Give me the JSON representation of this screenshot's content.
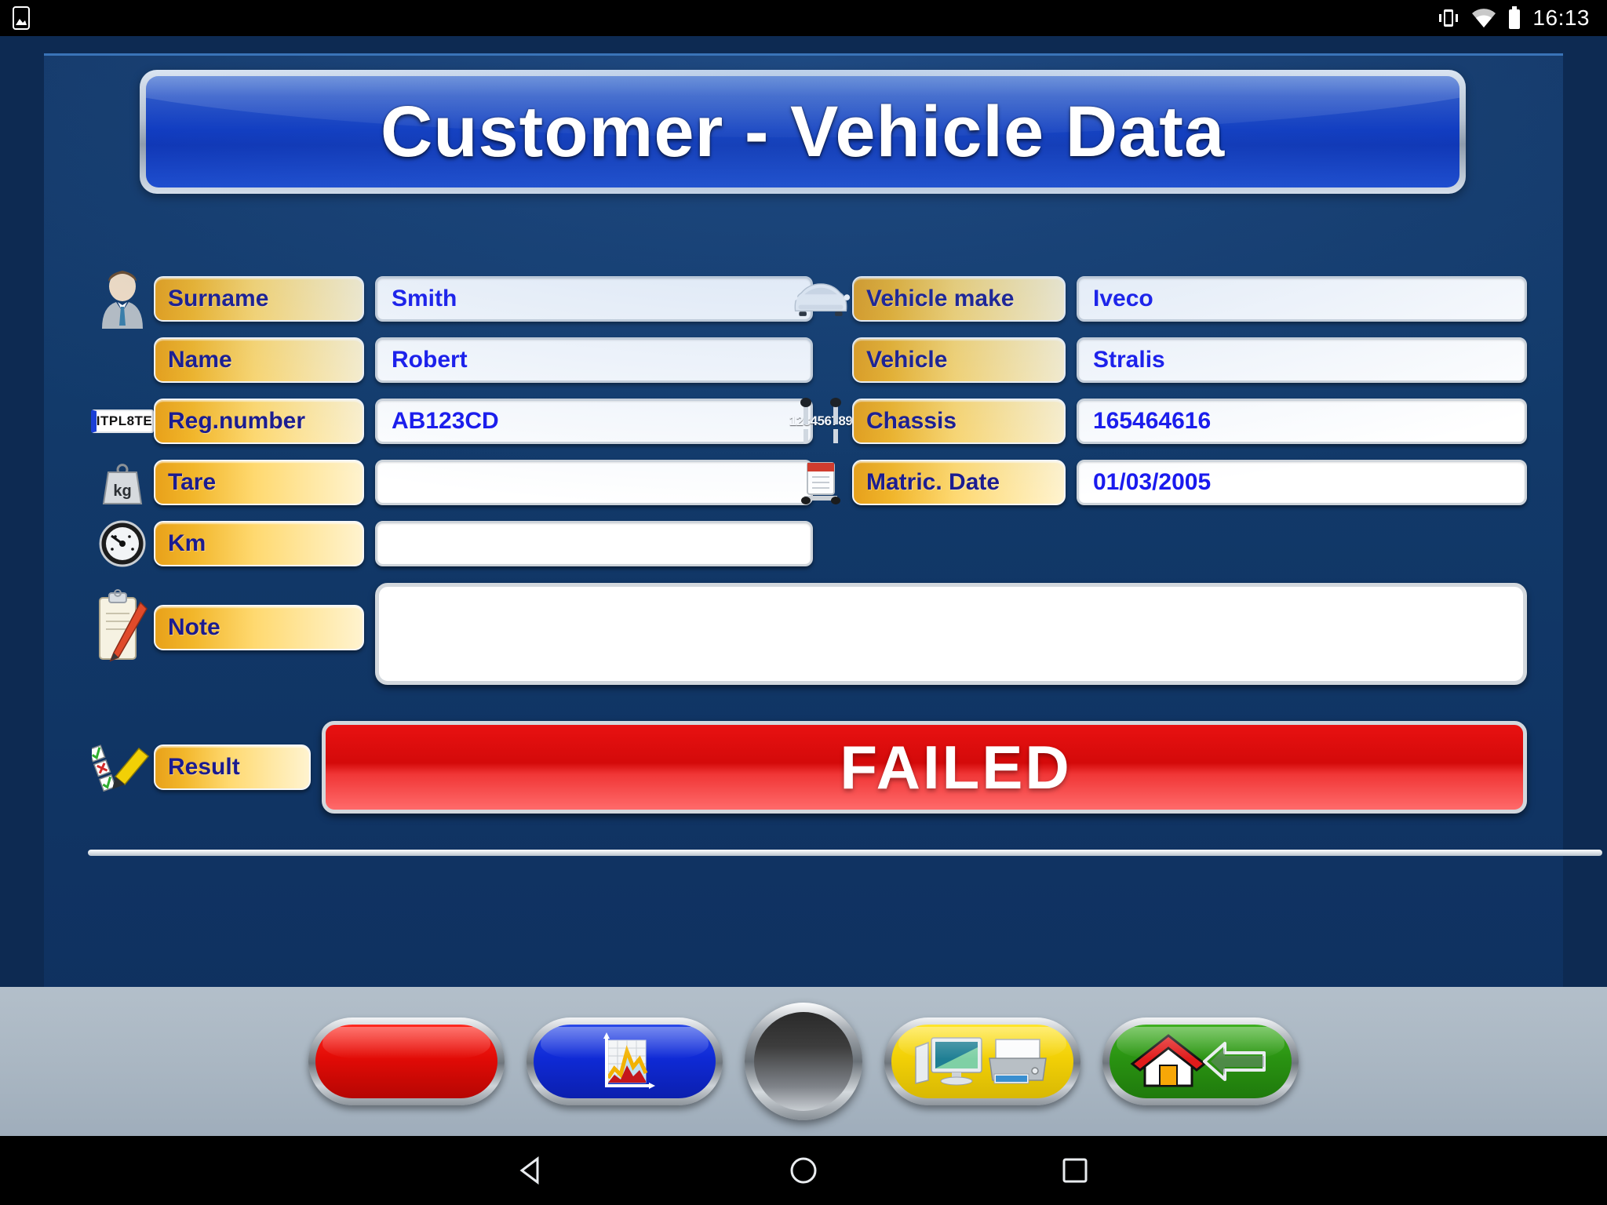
{
  "status_bar": {
    "time": "16:13",
    "icons": [
      "screenshot-icon",
      "vibrate-icon",
      "wifi-icon",
      "battery-icon"
    ]
  },
  "header": {
    "title": "Customer - Vehicle Data"
  },
  "form": {
    "left_fields": [
      {
        "icon": "person-icon",
        "label": "Surname",
        "value": "Smith"
      },
      {
        "icon": "person-icon",
        "label": "Name",
        "value": "Robert"
      },
      {
        "icon": "license-plate-icon",
        "plate_text": "ITPL8TE",
        "label": "Reg.number",
        "value": "AB123CD"
      },
      {
        "icon": "weight-kg-icon",
        "unit": "kg",
        "label": "Tare",
        "value": ""
      },
      {
        "icon": "speedometer-icon",
        "label": "Km",
        "value": ""
      }
    ],
    "right_fields": [
      {
        "icon": "car-icon",
        "label": "Vehicle make",
        "value": "Iveco"
      },
      {
        "icon": "car-icon",
        "label": "Vehicle",
        "value": "Stralis"
      },
      {
        "icon": "chassis-icon",
        "number": "123456789",
        "label": "Chassis",
        "value": "165464616"
      },
      {
        "icon": "calendar-icon",
        "label": "Matric. Date",
        "value": "01/03/2005"
      }
    ],
    "note": {
      "icon": "clipboard-pencil-icon",
      "label": "Note",
      "value": ""
    },
    "result": {
      "icon": "checklist-pencil-icon",
      "label": "Result",
      "value": "FAILED",
      "color": "#e20b06"
    }
  },
  "toolbar": {
    "buttons": [
      {
        "name": "stop-button",
        "icon": "blank-red-icon",
        "color": "#e20b06"
      },
      {
        "name": "chart-button",
        "icon": "chart-graph-icon",
        "color": "#0f2ad6"
      },
      {
        "name": "record-button",
        "icon": "dark-circle-icon",
        "color": "#3d3d3d"
      },
      {
        "name": "print-button",
        "icon": "monitor-printer-icon",
        "color": "#f2d006"
      },
      {
        "name": "home-button",
        "icon": "home-back-arrow-icon",
        "color": "#2a9312"
      }
    ]
  },
  "nav_bar": {
    "buttons": [
      {
        "name": "android-back-button",
        "icon": "triangle-back-icon"
      },
      {
        "name": "android-home-button",
        "icon": "circle-home-icon"
      },
      {
        "name": "android-recents-button",
        "icon": "square-recents-icon"
      }
    ]
  },
  "colors": {
    "app_background": "#123563",
    "label_gold": "#ffd970",
    "value_text": "#1a1aee",
    "title_blue": "#0b34c0",
    "fail_red": "#e20b06"
  }
}
